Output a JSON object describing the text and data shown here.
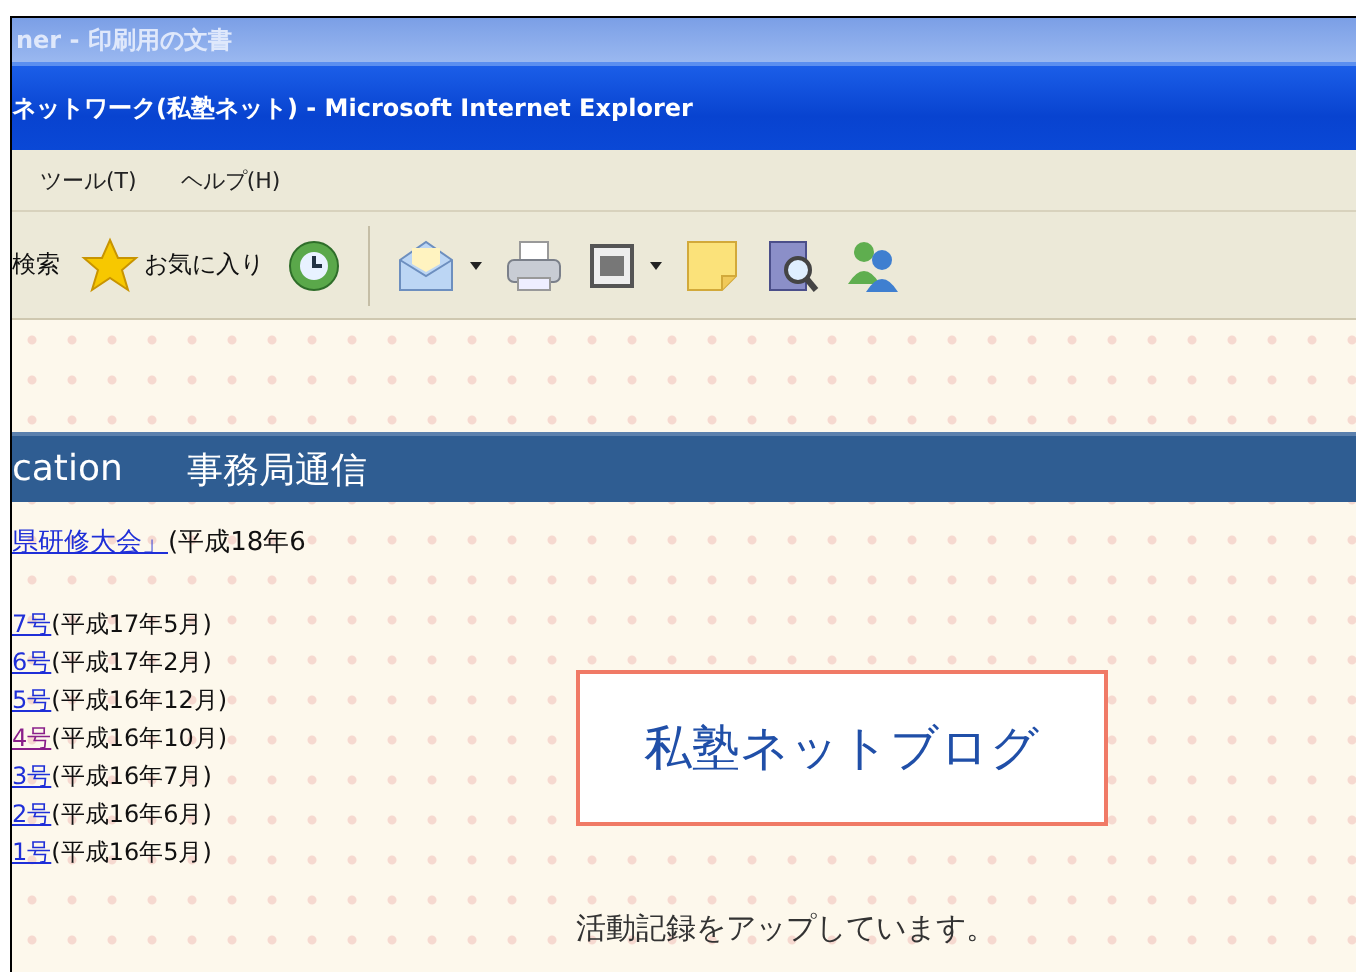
{
  "background_window": {
    "title": "ner - 印刷用の文書"
  },
  "window": {
    "title": "ネットワーク(私塾ネット) - Microsoft Internet Explorer"
  },
  "menu": [
    "ツール(T)",
    "ヘルプ(H)"
  ],
  "toolbar": [
    {
      "kind": "search",
      "label": "検索"
    },
    {
      "kind": "favorites",
      "label": "お気に入り"
    },
    {
      "kind": "history"
    },
    {
      "kind": "separator"
    },
    {
      "kind": "mail",
      "dropdown": true
    },
    {
      "kind": "print"
    },
    {
      "kind": "edit",
      "dropdown": true
    },
    {
      "kind": "note"
    },
    {
      "kind": "research"
    },
    {
      "kind": "messenger"
    }
  ],
  "page": {
    "header": [
      "cation",
      "事務局通信"
    ],
    "event": {
      "link": "県研修大会」",
      "note": "(平成18年6"
    },
    "issues": [
      {
        "link": "7号",
        "note": "(平成17年5月)",
        "visited": false
      },
      {
        "link": "6号",
        "note": "(平成17年2月)",
        "visited": false
      },
      {
        "link": "5号",
        "note": "(平成16年12月)",
        "visited": false
      },
      {
        "link": "4号",
        "note": "(平成16年10月)",
        "visited": true
      },
      {
        "link": "3号",
        "note": "(平成16年7月)",
        "visited": false
      },
      {
        "link": "2号",
        "note": "(平成16年6月)",
        "visited": false
      },
      {
        "link": "1号",
        "note": "(平成16年5月)",
        "visited": false
      }
    ],
    "blog": {
      "title": "私塾ネットブログ",
      "caption": "活動記録をアップしています。"
    }
  }
}
